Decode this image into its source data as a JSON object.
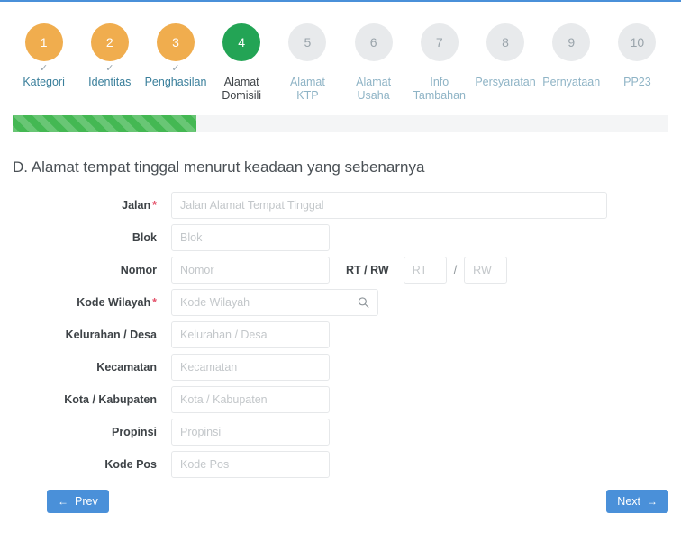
{
  "stepper": {
    "steps": [
      {
        "number": "1",
        "label": "Kategori",
        "state": "done",
        "check": "✓"
      },
      {
        "number": "2",
        "label": "Identitas",
        "state": "done",
        "check": "✓"
      },
      {
        "number": "3",
        "label": "Penghasilan",
        "state": "done",
        "check": "✓"
      },
      {
        "number": "4",
        "label": "Alamat\nDomisili",
        "state": "active",
        "check": ""
      },
      {
        "number": "5",
        "label": "Alamat\nKTP",
        "state": "todo",
        "check": ""
      },
      {
        "number": "6",
        "label": "Alamat\nUsaha",
        "state": "todo",
        "check": ""
      },
      {
        "number": "7",
        "label": "Info\nTambahan",
        "state": "todo",
        "check": ""
      },
      {
        "number": "8",
        "label": "Persyaratan",
        "state": "todo",
        "check": ""
      },
      {
        "number": "9",
        "label": "Pernyataan",
        "state": "todo",
        "check": ""
      },
      {
        "number": "10",
        "label": "PP23",
        "state": "todo",
        "check": ""
      }
    ]
  },
  "progress": {
    "percent": "28",
    "fill_color": "#44b853",
    "track_color": "#f4f5f6"
  },
  "heading": "D. Alamat tempat tinggal menurut keadaan yang sebenarnya",
  "form": {
    "jalan": {
      "label": "Jalan",
      "required": "*",
      "placeholder": "Jalan Alamat Tempat Tinggal",
      "value": ""
    },
    "blok": {
      "label": "Blok",
      "required": "",
      "placeholder": "Blok",
      "value": ""
    },
    "nomor": {
      "label": "Nomor",
      "required": "",
      "placeholder": "Nomor",
      "value": ""
    },
    "rtrw": {
      "label": "RT / RW",
      "separator": "/",
      "rt_placeholder": "RT",
      "rw_placeholder": "RW",
      "rt_value": "",
      "rw_value": ""
    },
    "kode_wilayah": {
      "label": "Kode Wilayah",
      "required": "*",
      "placeholder": "Kode Wilayah",
      "value": "",
      "icon": "search-icon"
    },
    "kelurahan": {
      "label": "Kelurahan / Desa",
      "required": "",
      "placeholder": "Kelurahan / Desa",
      "value": ""
    },
    "kecamatan": {
      "label": "Kecamatan",
      "required": "",
      "placeholder": "Kecamatan",
      "value": ""
    },
    "kota": {
      "label": "Kota / Kabupaten",
      "required": "",
      "placeholder": "Kota / Kabupaten",
      "value": ""
    },
    "propinsi": {
      "label": "Propinsi",
      "required": "",
      "placeholder": "Propinsi",
      "value": ""
    },
    "kode_pos": {
      "label": "Kode Pos",
      "required": "",
      "placeholder": "Kode Pos",
      "value": ""
    }
  },
  "buttons": {
    "prev": {
      "label": "Prev",
      "icon": "arrow-left-icon",
      "glyph": "←",
      "color": "#4a90d9"
    },
    "next": {
      "label": "Next",
      "icon": "arrow-right-icon",
      "glyph": "→",
      "color": "#4a90d9"
    }
  }
}
